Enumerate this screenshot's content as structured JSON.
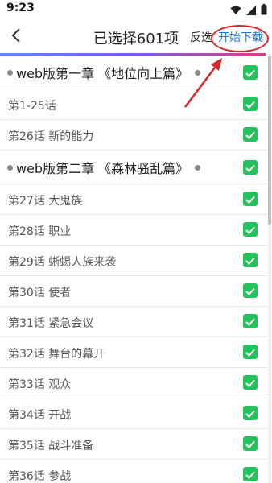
{
  "status_bar": {
    "time": "9:23",
    "icons": [
      "wifi-icon",
      "signal-icon",
      "battery-icon"
    ]
  },
  "header": {
    "title": "已选择601项",
    "reverse_label": "反选",
    "start_label": "开始下载",
    "back_icon": "chevron-left-icon"
  },
  "colors": {
    "accent": "#1e7ad6",
    "check": "#24c25a",
    "annotation": "#d6262b"
  },
  "list": {
    "rows": [
      {
        "type": "chapter",
        "label": "web版第一章 《地位向上篇》",
        "checked": true
      },
      {
        "type": "episode",
        "label": "第1-25话",
        "checked": true
      },
      {
        "type": "episode",
        "label": "第26话 新的能力",
        "checked": true
      },
      {
        "type": "chapter",
        "label": "web版第二章 《森林骚乱篇》",
        "checked": true
      },
      {
        "type": "episode",
        "label": "第27话 大鬼族",
        "checked": true
      },
      {
        "type": "episode",
        "label": "第28话 职业",
        "checked": true
      },
      {
        "type": "episode",
        "label": "第29话 蜥蜴人族来袭",
        "checked": true
      },
      {
        "type": "episode",
        "label": "第30话 使者",
        "checked": true
      },
      {
        "type": "episode",
        "label": "第31话 紧急会议",
        "checked": true
      },
      {
        "type": "episode",
        "label": "第32话 舞台的幕开",
        "checked": true
      },
      {
        "type": "episode",
        "label": "第33话 观众",
        "checked": true
      },
      {
        "type": "episode",
        "label": "第34话 开战",
        "checked": true
      },
      {
        "type": "episode",
        "label": "第35话 战斗准备",
        "checked": true
      },
      {
        "type": "episode",
        "label": "第36话 参战",
        "checked": true
      }
    ]
  }
}
